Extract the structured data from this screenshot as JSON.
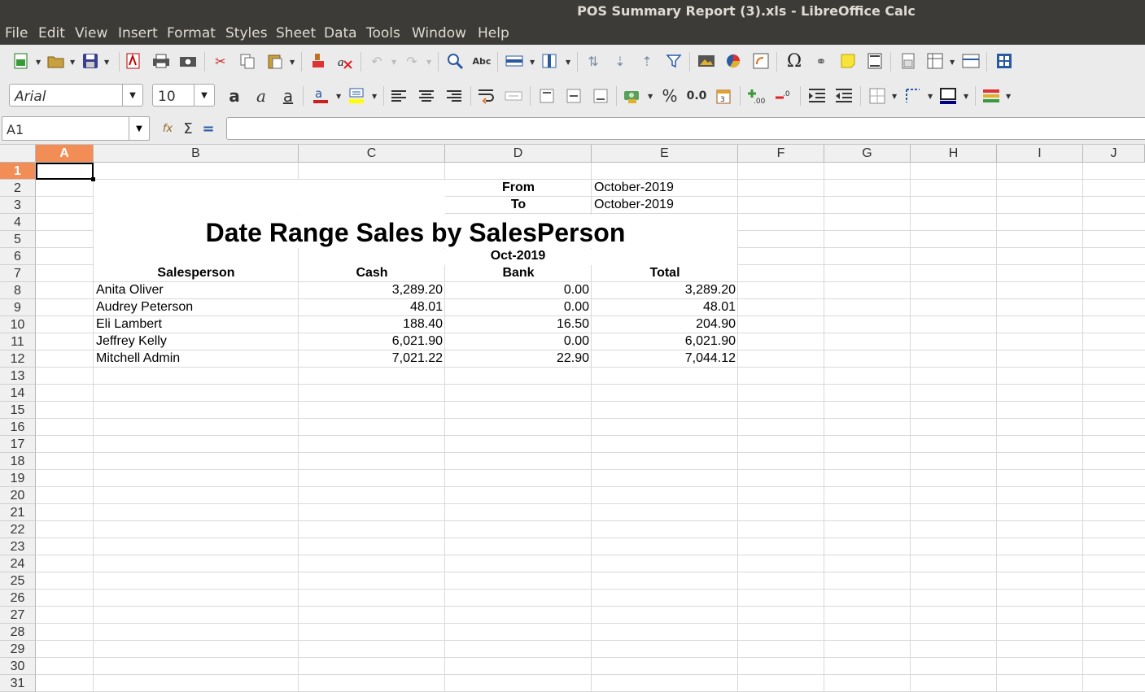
{
  "window_title": "POS Summary Report (3).xls - LibreOffice Calc",
  "menu": [
    "File",
    "Edit",
    "View",
    "Insert",
    "Format",
    "Styles",
    "Sheet",
    "Data",
    "Tools",
    "Window",
    "Help"
  ],
  "font_name": "Arial",
  "font_size": "10",
  "percent_label": "%",
  "number_format_label": "0.0",
  "name_box": "A1",
  "formula_content": "",
  "columns": [
    "A",
    "B",
    "C",
    "D",
    "E",
    "F",
    "G",
    "H",
    "I",
    "J"
  ],
  "rows": [
    "1",
    "2",
    "3",
    "4",
    "5",
    "6",
    "7",
    "8",
    "9",
    "10",
    "11",
    "12",
    "13",
    "14",
    "15",
    "16",
    "17",
    "18",
    "19",
    "20",
    "21",
    "22",
    "23",
    "24",
    "25",
    "26",
    "27",
    "28",
    "29",
    "30",
    "31"
  ],
  "sheet": {
    "from_label": "From",
    "from_value": "October-2019",
    "to_label": "To",
    "to_value": "October-2019",
    "title": "Date Range Sales by SalesPerson",
    "period": "Oct-2019",
    "headers": {
      "salesperson": "Salesperson",
      "cash": "Cash",
      "bank": "Bank",
      "total": "Total"
    },
    "rows": [
      {
        "name": "Anita Oliver",
        "cash": "3,289.20",
        "bank": "0.00",
        "total": "3,289.20"
      },
      {
        "name": "Audrey Peterson",
        "cash": "48.01",
        "bank": "0.00",
        "total": "48.01"
      },
      {
        "name": "Eli Lambert",
        "cash": "188.40",
        "bank": "16.50",
        "total": "204.90"
      },
      {
        "name": "Jeffrey Kelly",
        "cash": "6,021.90",
        "bank": "0.00",
        "total": "6,021.90"
      },
      {
        "name": "Mitchell Admin",
        "cash": "7,021.22",
        "bank": "22.90",
        "total": "7,044.12"
      }
    ]
  },
  "colors": {
    "titlebar": "#3c3b37",
    "selection_header": "#f28d55",
    "toolbar": "#ebebeb"
  }
}
